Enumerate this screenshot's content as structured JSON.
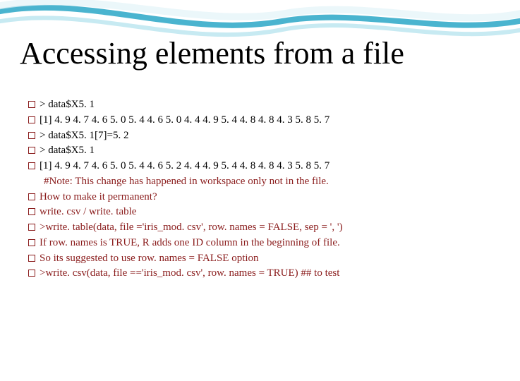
{
  "title": "Accessing elements from a file",
  "lines": {
    "l1": "> data$X5. 1",
    "l2": " [1] 4. 9  4. 7  4. 6  5. 0  5. 4  4. 6  5. 0  4. 4  4. 9  5. 4  4. 8  4. 8  4. 3  5. 8  5. 7",
    "l3": "> data$X5. 1[7]=5. 2",
    "l4": "> data$X5. 1",
    "l5": "  [1] 4. 9  4. 7  4. 6  5. 0  5. 4  4. 6  5. 2  4. 4  4. 9  5. 4  4. 8  4. 8  4. 3  5. 8  5. 7",
    "note": "#Note: This change has happened in workspace only not in the file.",
    "l6": "How to make it permanent?",
    "l7": "write. csv / write. table",
    "l8": ">write. table(data, file ='iris_mod. csv', row. names = FALSE, sep = ', ')",
    "l9": "If  row. names is TRUE, R adds one ID column in the beginning of file.",
    "l10": "So its suggested to use row. names = FALSE option",
    "l11": ">write. csv(data, file =='iris_mod. csv', row. names = TRUE)   ## to test"
  }
}
